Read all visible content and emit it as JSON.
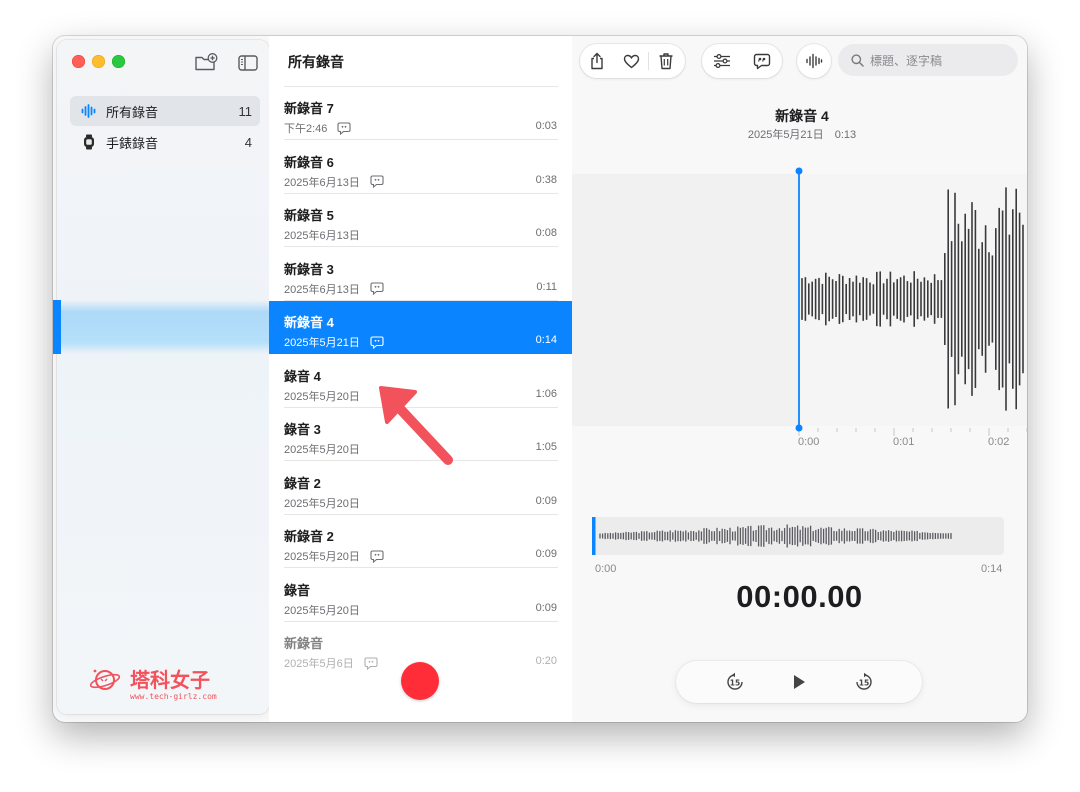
{
  "sidebar": {
    "items": [
      {
        "label": "所有錄音",
        "count": "11",
        "icon": "waveform-icon",
        "active": true
      },
      {
        "label": "手錶錄音",
        "count": "4",
        "icon": "watch-icon",
        "active": false
      }
    ],
    "logo": {
      "name": "塔科女子",
      "url": "www.tech-girlz.com"
    }
  },
  "list": {
    "title": "所有錄音",
    "recordings": [
      {
        "title": "新錄音 7",
        "subtitle": "下午2:46",
        "duration": "0:03",
        "transcript": true
      },
      {
        "title": "新錄音 6",
        "subtitle": "2025年6月13日",
        "duration": "0:38",
        "transcript": true
      },
      {
        "title": "新錄音 5",
        "subtitle": "2025年6月13日",
        "duration": "0:08",
        "transcript": false
      },
      {
        "title": "新錄音 3",
        "subtitle": "2025年6月13日",
        "duration": "0:11",
        "transcript": true
      },
      {
        "title": "新錄音 4",
        "subtitle": "2025年5月21日",
        "duration": "0:14",
        "transcript": true,
        "selected": true
      },
      {
        "title": "錄音 4",
        "subtitle": "2025年5月20日",
        "duration": "1:06",
        "transcript": false
      },
      {
        "title": "錄音 3",
        "subtitle": "2025年5月20日",
        "duration": "1:05",
        "transcript": false
      },
      {
        "title": "錄音 2",
        "subtitle": "2025年5月20日",
        "duration": "0:09",
        "transcript": false
      },
      {
        "title": "新錄音 2",
        "subtitle": "2025年5月20日",
        "duration": "0:09",
        "transcript": true
      },
      {
        "title": "錄音",
        "subtitle": "2025年5月20日",
        "duration": "0:09",
        "transcript": false
      },
      {
        "title": "新錄音",
        "subtitle": "2025年5月6日",
        "duration": "0:20",
        "transcript": true
      }
    ]
  },
  "detail": {
    "search_placeholder": "標題、逐字稿",
    "title": "新錄音 4",
    "date": "2025年5月21日",
    "length": "0:13",
    "ticks": [
      "0:00",
      "0:01",
      "0:02"
    ],
    "overview_start": "0:00",
    "overview_end": "0:14",
    "timer": "00:00.00",
    "skip_seconds": "15",
    "playhead_fraction": 0.0
  },
  "colors": {
    "accent": "#0a84ff",
    "record": "#ff2d37",
    "annotation": "#f2525b"
  }
}
